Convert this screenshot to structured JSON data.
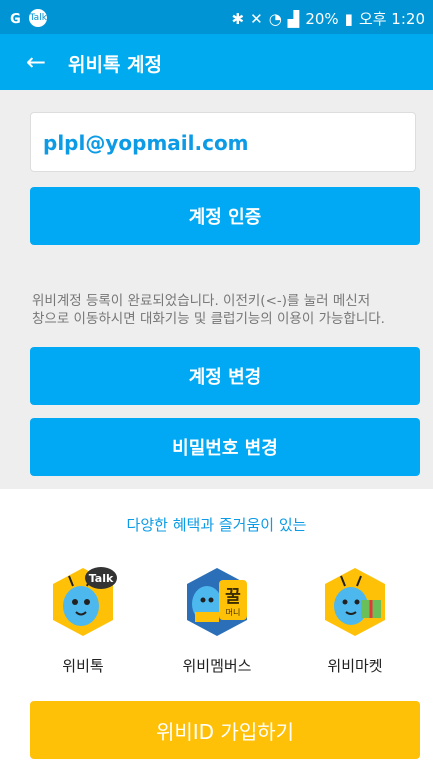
{
  "status_bar": {
    "left_icons": [
      "g-logo-icon",
      "talk-bubble-icon"
    ],
    "talk_icon_text": "Talk",
    "battery": "20%",
    "time": "오후 1:20"
  },
  "header": {
    "title": "위비톡 계정"
  },
  "account": {
    "email": "plpl@yopmail.com",
    "verify_label": "계정 인증",
    "notice_line1": "위비계정 등록이 완료되었습니다. 이전키(<-)를 눌러 메신저",
    "notice_line2": "창으로 이동하시면 대화기능 및 클럽기능의 이용이 가능합니다.",
    "change_account_label": "계정 변경",
    "change_password_label": "비밀번호 변경"
  },
  "promo": {
    "text": "다양한 혜택과 즐거움이 있는",
    "apps": [
      {
        "label": "위비톡",
        "icon": "wibee-talk-icon",
        "badge": "Talk"
      },
      {
        "label": "위비멤버스",
        "icon": "wibee-members-icon",
        "badge": "꿀",
        "sub_badge": "머니"
      },
      {
        "label": "위비마켓",
        "icon": "wibee-market-icon"
      }
    ]
  },
  "join_label": "위비ID 가입하기",
  "colors": {
    "status_bar": "#0094d4",
    "app_bar": "#00aaee",
    "primary_button": "#01a9f4",
    "join_button": "#ffc107",
    "link_text": "#0d9be6"
  }
}
